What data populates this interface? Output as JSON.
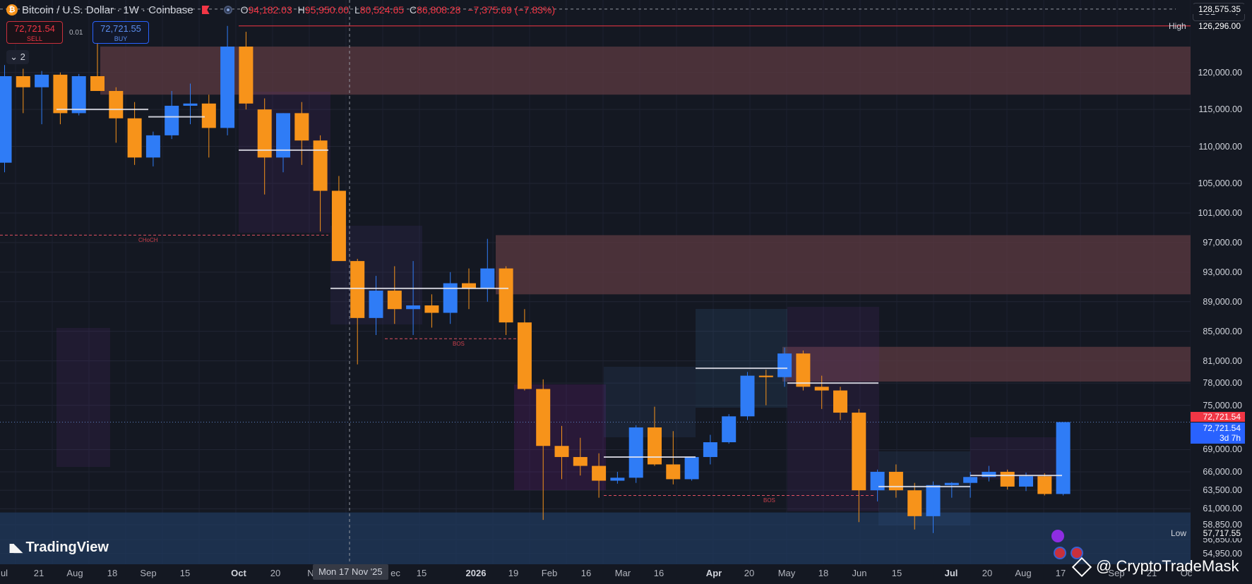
{
  "header": {
    "symbol_icon": "bitcoin-icon",
    "title": "Bitcoin / U.S. Dollar · 1W · Coinbase",
    "ohlc": {
      "open_label": "O",
      "open": "94,182.03",
      "high_label": "H",
      "high": "95,950.00",
      "low_label": "L",
      "low": "80,524.65",
      "close_label": "C",
      "close": "86,808.28",
      "change": "−7,375.69 (−7.83%)"
    }
  },
  "trade": {
    "sell_price": "72,721.54",
    "sell_label": "SELL",
    "buy_price": "72,721.55",
    "buy_label": "BUY",
    "spread": "0.01"
  },
  "indicator_count": "2",
  "currency": "USD",
  "price_axis": {
    "ticks": [
      "120,000.00",
      "115,000.00",
      "110,000.00",
      "105,000.00",
      "101,000.00",
      "97,000.00",
      "93,000.00",
      "89,000.00",
      "85,000.00",
      "81,000.00",
      "78,000.00",
      "75,000.00",
      "69,000.00",
      "66,000.00",
      "63,500.00",
      "61,000.00",
      "58,850.00",
      "56,850.00",
      "54,950.00"
    ],
    "crosshair_price": "128,575.35",
    "high_label": "High",
    "high_value": "126,296.00",
    "low_label": "Low",
    "low_value": "57,717.55",
    "last_price": "72,721.54",
    "last_price_2": "72,721.54",
    "countdown": "3d 7h"
  },
  "time_axis": {
    "labels": [
      "ul",
      "21",
      "Aug",
      "18",
      "Sep",
      "15",
      "Oct",
      "20",
      "N",
      "ec",
      "15",
      "2026",
      "19",
      "Feb",
      "16",
      "Mar",
      "16",
      "Apr",
      "20",
      "May",
      "18",
      "Jun",
      "15",
      "Jul",
      "20",
      "Aug",
      "17",
      "Sep",
      "21",
      "Oc"
    ],
    "crosshair_date": "Mon 17 Nov '25"
  },
  "annotations": {
    "choch": "CHoCH",
    "bos_1": "BOS",
    "bos_2": "BOS"
  },
  "branding": {
    "logo": "TradingView",
    "watermark": "@ CryptoTradeMask"
  },
  "colors": {
    "up": "#2f7cf6",
    "down": "#f7931a",
    "sell": "#f23645",
    "buy": "#2962ff",
    "supply_zone": "#5c3a42",
    "demand_zone": "#1f3a60"
  },
  "chart_data": {
    "type": "candlestick",
    "interval": "1W",
    "ylim": [
      53500,
      129800
    ],
    "candles": [
      {
        "t": "2025-07-14",
        "o": 107800,
        "h": 121000,
        "l": 106500,
        "c": 119500
      },
      {
        "t": "2025-07-21",
        "o": 119500,
        "h": 120500,
        "l": 114500,
        "c": 118000
      },
      {
        "t": "2025-07-28",
        "o": 118000,
        "h": 120200,
        "l": 113000,
        "c": 119700
      },
      {
        "t": "2025-08-04",
        "o": 119700,
        "h": 120000,
        "l": 113000,
        "c": 114500
      },
      {
        "t": "2025-08-11",
        "o": 114500,
        "h": 119800,
        "l": 114200,
        "c": 119500
      },
      {
        "t": "2025-08-18",
        "o": 119500,
        "h": 124000,
        "l": 117500,
        "c": 117500
      },
      {
        "t": "2025-08-25",
        "o": 117500,
        "h": 118000,
        "l": 110500,
        "c": 113800
      },
      {
        "t": "2025-09-01",
        "o": 113800,
        "h": 116000,
        "l": 107500,
        "c": 108500
      },
      {
        "t": "2025-09-08",
        "o": 108500,
        "h": 112000,
        "l": 107300,
        "c": 111500
      },
      {
        "t": "2025-09-15",
        "o": 111500,
        "h": 117500,
        "l": 111000,
        "c": 115500
      },
      {
        "t": "2025-09-22",
        "o": 115500,
        "h": 118500,
        "l": 113000,
        "c": 115800
      },
      {
        "t": "2025-09-29",
        "o": 115800,
        "h": 117000,
        "l": 108500,
        "c": 112500
      },
      {
        "t": "2025-10-06",
        "o": 112500,
        "h": 126296,
        "l": 111500,
        "c": 123500
      },
      {
        "t": "2025-10-13",
        "o": 123500,
        "h": 125500,
        "l": 115000,
        "c": 115800
      },
      {
        "t": "2025-10-20",
        "o": 115000,
        "h": 116500,
        "l": 103500,
        "c": 108500
      },
      {
        "t": "2025-10-27",
        "o": 108500,
        "h": 114500,
        "l": 106500,
        "c": 114500
      },
      {
        "t": "2025-11-03",
        "o": 114500,
        "h": 116000,
        "l": 107500,
        "c": 110800
      },
      {
        "t": "2025-11-10",
        "o": 110800,
        "h": 111500,
        "l": 98500,
        "c": 104000
      },
      {
        "t": "2025-11-17",
        "o": 104000,
        "h": 106000,
        "l": 96000,
        "c": 94500
      },
      {
        "t": "2025-11-24",
        "o": 94500,
        "h": 94800,
        "l": 80524,
        "c": 86800
      },
      {
        "t": "2025-12-01",
        "o": 86800,
        "h": 92500,
        "l": 84500,
        "c": 90500
      },
      {
        "t": "2025-12-08",
        "o": 90500,
        "h": 93800,
        "l": 86000,
        "c": 88000
      },
      {
        "t": "2025-12-15",
        "o": 88000,
        "h": 94500,
        "l": 84500,
        "c": 88500
      },
      {
        "t": "2025-12-22",
        "o": 88500,
        "h": 90000,
        "l": 85500,
        "c": 87500
      },
      {
        "t": "2025-12-29",
        "o": 87500,
        "h": 93000,
        "l": 86000,
        "c": 91500
      },
      {
        "t": "2026-01-05",
        "o": 91500,
        "h": 93500,
        "l": 88000,
        "c": 90800
      },
      {
        "t": "2026-01-12",
        "o": 90800,
        "h": 97500,
        "l": 89000,
        "c": 93500
      },
      {
        "t": "2026-01-19",
        "o": 93500,
        "h": 93800,
        "l": 84500,
        "c": 86200
      },
      {
        "t": "2026-01-26",
        "o": 86200,
        "h": 88000,
        "l": 77000,
        "c": 77200
      },
      {
        "t": "2026-02-02",
        "o": 77200,
        "h": 78500,
        "l": 59500,
        "c": 69500
      },
      {
        "t": "2026-02-09",
        "o": 69500,
        "h": 72200,
        "l": 65000,
        "c": 68000
      },
      {
        "t": "2026-02-16",
        "o": 68000,
        "h": 70600,
        "l": 65500,
        "c": 66800
      },
      {
        "t": "2026-02-23",
        "o": 66800,
        "h": 68500,
        "l": 62500,
        "c": 64800
      },
      {
        "t": "2026-03-02",
        "o": 64800,
        "h": 66000,
        "l": 64400,
        "c": 65200
      },
      {
        "t": "2026-03-09",
        "o": 65200,
        "h": 72300,
        "l": 64500,
        "c": 72000
      },
      {
        "t": "2026-03-16",
        "o": 72000,
        "h": 74800,
        "l": 66800,
        "c": 67000
      },
      {
        "t": "2026-03-23",
        "o": 67000,
        "h": 71500,
        "l": 64300,
        "c": 65000
      },
      {
        "t": "2026-03-30",
        "o": 65000,
        "h": 68000,
        "l": 64800,
        "c": 68000
      },
      {
        "t": "2026-04-06",
        "o": 68000,
        "h": 71000,
        "l": 67000,
        "c": 70000
      },
      {
        "t": "2026-04-13",
        "o": 70000,
        "h": 73800,
        "l": 69800,
        "c": 73500
      },
      {
        "t": "2026-04-20",
        "o": 73500,
        "h": 79500,
        "l": 73000,
        "c": 79000
      },
      {
        "t": "2026-04-27",
        "o": 79000,
        "h": 79800,
        "l": 75000,
        "c": 78800
      },
      {
        "t": "2026-05-04",
        "o": 78800,
        "h": 82800,
        "l": 77500,
        "c": 82000
      },
      {
        "t": "2026-05-11",
        "o": 82000,
        "h": 82400,
        "l": 77000,
        "c": 77500
      },
      {
        "t": "2026-05-18",
        "o": 77500,
        "h": 79000,
        "l": 74500,
        "c": 77000
      },
      {
        "t": "2026-05-25",
        "o": 77000,
        "h": 77500,
        "l": 73000,
        "c": 74000
      },
      {
        "t": "2026-06-01",
        "o": 74000,
        "h": 74500,
        "l": 59200,
        "c": 63500
      },
      {
        "t": "2026-06-08",
        "o": 63500,
        "h": 66300,
        "l": 62000,
        "c": 66000
      },
      {
        "t": "2026-06-15",
        "o": 66000,
        "h": 67000,
        "l": 62500,
        "c": 63500
      },
      {
        "t": "2026-06-22",
        "o": 63500,
        "h": 64500,
        "l": 58200,
        "c": 60000
      },
      {
        "t": "2026-06-29",
        "o": 60000,
        "h": 64700,
        "l": 57717,
        "c": 64200
      },
      {
        "t": "2026-07-06",
        "o": 64200,
        "h": 64600,
        "l": 62500,
        "c": 64500
      },
      {
        "t": "2026-07-13",
        "o": 64500,
        "h": 66000,
        "l": 62500,
        "c": 65300
      },
      {
        "t": "2026-07-20",
        "o": 65300,
        "h": 66800,
        "l": 64700,
        "c": 66000
      },
      {
        "t": "2026-07-27",
        "o": 66000,
        "h": 66300,
        "l": 63600,
        "c": 64000
      },
      {
        "t": "2026-08-03",
        "o": 64000,
        "h": 65900,
        "l": 63400,
        "c": 65400
      },
      {
        "t": "2026-08-10",
        "o": 65400,
        "h": 65800,
        "l": 62800,
        "c": 63000
      },
      {
        "t": "2026-08-17",
        "o": 63000,
        "h": 72721,
        "l": 62800,
        "c": 72721
      }
    ],
    "supply_zones": [
      [
        117000,
        123500
      ],
      [
        90000,
        98000
      ],
      [
        78200,
        82900
      ]
    ],
    "demand_zones": [
      [
        53500,
        60500
      ]
    ],
    "lines": {
      "high": 126296,
      "choch": 98000,
      "bos_1": 84000,
      "bos_2": 62800,
      "crosshair": 128575,
      "last": 72721
    }
  }
}
